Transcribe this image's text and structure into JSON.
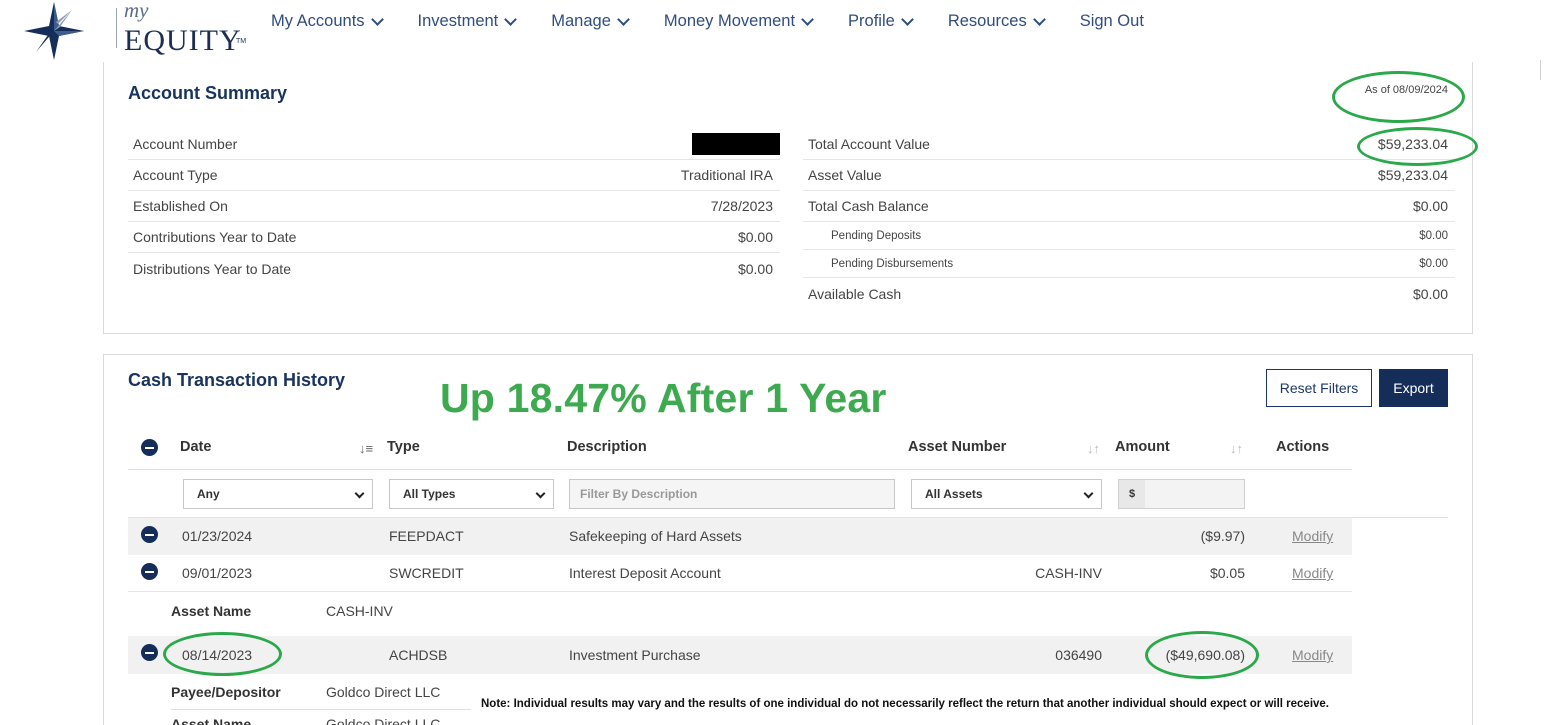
{
  "header": {
    "logo_my": "my",
    "logo_equity": "EQUITY",
    "logo_tm": "TM",
    "nav": [
      {
        "label": "My Accounts"
      },
      {
        "label": "Investment"
      },
      {
        "label": "Manage"
      },
      {
        "label": "Money Movement"
      },
      {
        "label": "Profile"
      },
      {
        "label": "Resources"
      },
      {
        "label": "Sign Out"
      }
    ]
  },
  "summary": {
    "title": "Account Summary",
    "as_of": "As of 08/09/2024",
    "left": [
      {
        "label": "Account Number",
        "value": ""
      },
      {
        "label": "Account Type",
        "value": "Traditional IRA"
      },
      {
        "label": "Established On",
        "value": "7/28/2023"
      },
      {
        "label": "Contributions Year to Date",
        "value": "$0.00"
      },
      {
        "label": "Distributions Year to Date",
        "value": "$0.00"
      }
    ],
    "right": [
      {
        "label": "Total Account Value",
        "value": "$59,233.04"
      },
      {
        "label": "Asset Value",
        "value": "$59,233.04"
      },
      {
        "label": "Total Cash Balance",
        "value": "$0.00"
      },
      {
        "label": "Pending Deposits",
        "value": "$0.00"
      },
      {
        "label": "Pending Disbursements",
        "value": "$0.00"
      },
      {
        "label": "Available Cash",
        "value": "$0.00"
      }
    ]
  },
  "history": {
    "title": "Cash Transaction History",
    "headline": "Up 18.47% After 1 Year",
    "reset_label": "Reset Filters",
    "export_label": "Export",
    "columns": {
      "date": "Date",
      "type": "Type",
      "description": "Description",
      "asset_number": "Asset Number",
      "amount": "Amount",
      "actions": "Actions"
    },
    "filters": {
      "date": "Any",
      "type": "All Types",
      "description_placeholder": "Filter By Description",
      "asset": "All Assets",
      "currency": "$"
    },
    "rows": [
      {
        "date": "01/23/2024",
        "type": "FEEPDACT",
        "description": "Safekeeping of Hard Assets",
        "asset": "",
        "amount": "($9.97)",
        "action": "Modify"
      },
      {
        "date": "09/01/2023",
        "type": "SWCREDIT",
        "description": "Interest Deposit Account",
        "asset": "CASH-INV",
        "amount": "$0.05",
        "action": "Modify"
      },
      {
        "date": "08/14/2023",
        "type": "ACHDSB",
        "description": "Investment Purchase",
        "asset": "036490",
        "amount": "($49,690.08)",
        "action": "Modify"
      }
    ],
    "details": {
      "asset_name_label": "Asset Name",
      "asset_name_value": "CASH-INV",
      "payee_label": "Payee/Depositor",
      "payee_value": "Goldco Direct LLC",
      "asset_name_label_2": "Asset Name",
      "asset_name_value_2": "Goldco Direct LLC"
    },
    "note": "Note: Individual results may vary and the results of one individual do not necessarily reflect the return that another individual should expect or will receive."
  },
  "colors": {
    "navy": "#142e59",
    "nav_text": "#2f4d7e",
    "highlight_green": "#2aa84a"
  }
}
